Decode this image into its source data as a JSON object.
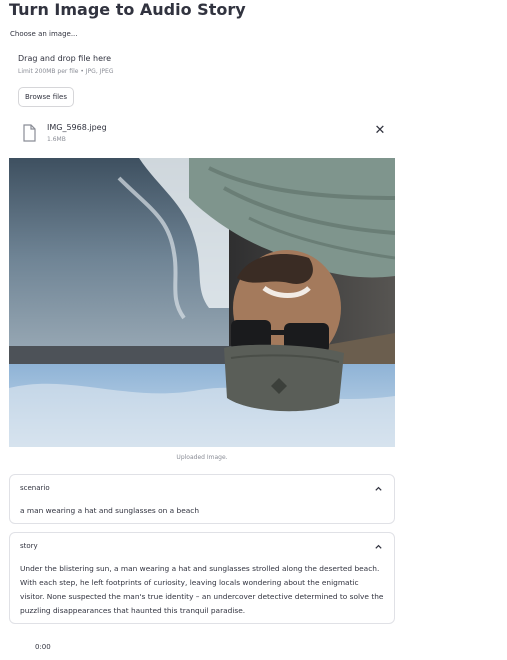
{
  "app": {
    "title": "Turn Image to Audio Story"
  },
  "uploader": {
    "label": "Choose an image...",
    "drop_title": "Drag and drop file here",
    "limit_text": "Limit 200MB per file • JPG, JPEG",
    "browse_label": "Browse files",
    "file": {
      "name": "IMG_5968.jpeg",
      "size": "1.6MB",
      "icon": "file-icon",
      "remove_icon": "close-icon"
    }
  },
  "image": {
    "caption": "Uploaded Image."
  },
  "scenario": {
    "header": "scenario",
    "text": "a man wearing a hat and sunglasses on a beach",
    "icon": "chevron-up-icon"
  },
  "story": {
    "header": "story",
    "text": "Under the blistering sun, a man wearing a hat and sunglasses strolled along the deserted beach. With each step, he left footprints of curiosity, leaving locals wondering about the enigmatic visitor. None suspected the man's true identity – an undercover detective determined to solve the puzzling disappearances that haunted this tranquil paradise.",
    "icon": "chevron-up-icon"
  },
  "audio": {
    "time": "0:00"
  },
  "colors": {
    "text": "#31333f",
    "muted": "#8a8d96",
    "border": "#e0e1e6"
  }
}
